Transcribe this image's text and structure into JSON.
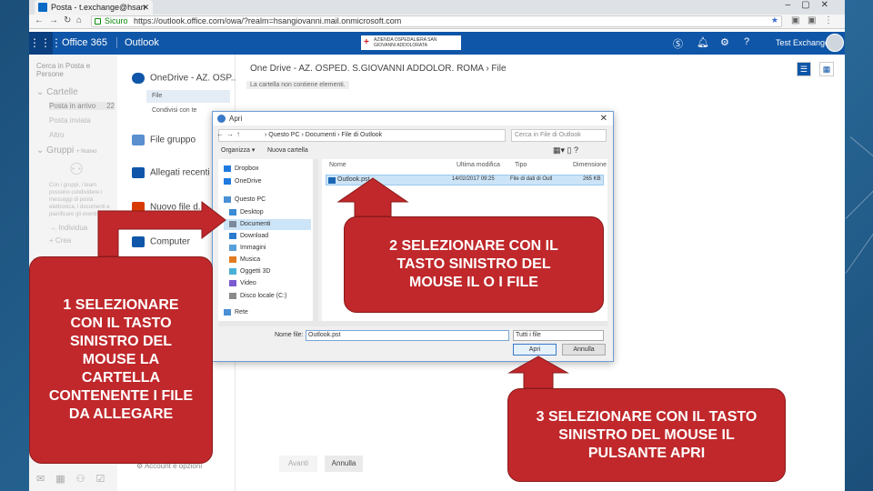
{
  "browser": {
    "tab_title": "Posta - t.exchange@hsan",
    "tab_close": "✕",
    "url_secure": "Sicuro",
    "url": "https://outlook.office.com/owa/?realm=hsangiovanni.mail.onmicrosoft.com"
  },
  "o365": {
    "brand": "Office 365",
    "app": "Outlook",
    "logo_text": "AZIENDA OSPEDALIERA SAN GIOVANNI ADDOLORATA",
    "user": "Test Exchange"
  },
  "left_pane": {
    "search": "Cerca in Posta e Persone",
    "folders_header": "Cartelle",
    "inbox": "Posta in arrivo",
    "inbox_count": "22",
    "sent": "Posta inviata",
    "other": "Altro",
    "groups_header": "Gruppi",
    "groups_new": "+ Nuovo",
    "groups_text": "Con i gruppi, i team possono condividere i messaggi di posta elettronica, i documenti e pianificare gli eventi.",
    "discover": "Individua",
    "create": "Crea"
  },
  "attach_pane": {
    "onedrive": "OneDrive - AZ. OSP...",
    "file": "File",
    "shared": "Condivisi con te",
    "group_files": "File gruppo",
    "recent": "Allegati recenti",
    "new_file": "Nuovo file d...",
    "computer": "Computer"
  },
  "main_pane": {
    "breadcrumb": "One Drive - AZ. OSPED. S.GIOVANNI ADDOLOR. ROMA  ›  File",
    "empty_note": "La cartella non contiene elementi.",
    "next_button": "Avanti",
    "cancel_button": "Annulla",
    "account_options": "Account e opzioni"
  },
  "dialog": {
    "title": "Apri",
    "path": "›  Questo PC  ›  Documenti  ›  File di Outlook",
    "search_placeholder": "Cerca in File di Outlook",
    "organize": "Organizza ▾",
    "new_folder": "Nuova cartella",
    "tree": [
      {
        "label": "Dropbox",
        "color": "#1f7ae0"
      },
      {
        "label": "OneDrive",
        "color": "#1f7ae0"
      },
      {
        "label": "Questo PC",
        "color": "#4a8fd6"
      },
      {
        "label": "Desktop",
        "color": "#3c8bd4"
      },
      {
        "label": "Documenti",
        "color": "#7a8a9a"
      },
      {
        "label": "Download",
        "color": "#2a7ad0"
      },
      {
        "label": "Immagini",
        "color": "#5aa0d8"
      },
      {
        "label": "Musica",
        "color": "#e07b20"
      },
      {
        "label": "Oggetti 3D",
        "color": "#4ab0d8"
      },
      {
        "label": "Video",
        "color": "#7a5ad0"
      },
      {
        "label": "Disco locale (C:)",
        "color": "#8a8a8a"
      },
      {
        "label": "Rete",
        "color": "#4a8fd6"
      }
    ],
    "columns": {
      "name": "Nome",
      "modified": "Ultima modifica",
      "type": "Tipo",
      "size": "Dimensione"
    },
    "file": {
      "name": "Outlook.pst",
      "modified": "14/02/2017 09:25",
      "type": "File di dati di Outl",
      "size": "265 KB"
    },
    "filename_label": "Nome file:",
    "filename_value": "Outlook.pst",
    "filetype": "Tutti i file",
    "open_button": "Apri",
    "cancel_button": "Annulla"
  },
  "callouts": {
    "step1": "1 SELEZIONARE CON IL TASTO SINISTRO DEL MOUSE LA CARTELLA CONTENENTE I FILE DA ALLEGARE",
    "step2": "2 SELEZIONARE CON IL TASTO SINISTRO DEL MOUSE IL O I FILE",
    "step3": "3 SELEZIONARE CON IL TASTO SINISTRO DEL MOUSE IL PULSANTE APRI"
  },
  "colors": {
    "callout_red": "#c0282b",
    "o365_blue": "#0f56a8",
    "slide_blue": "#1e5a86"
  }
}
